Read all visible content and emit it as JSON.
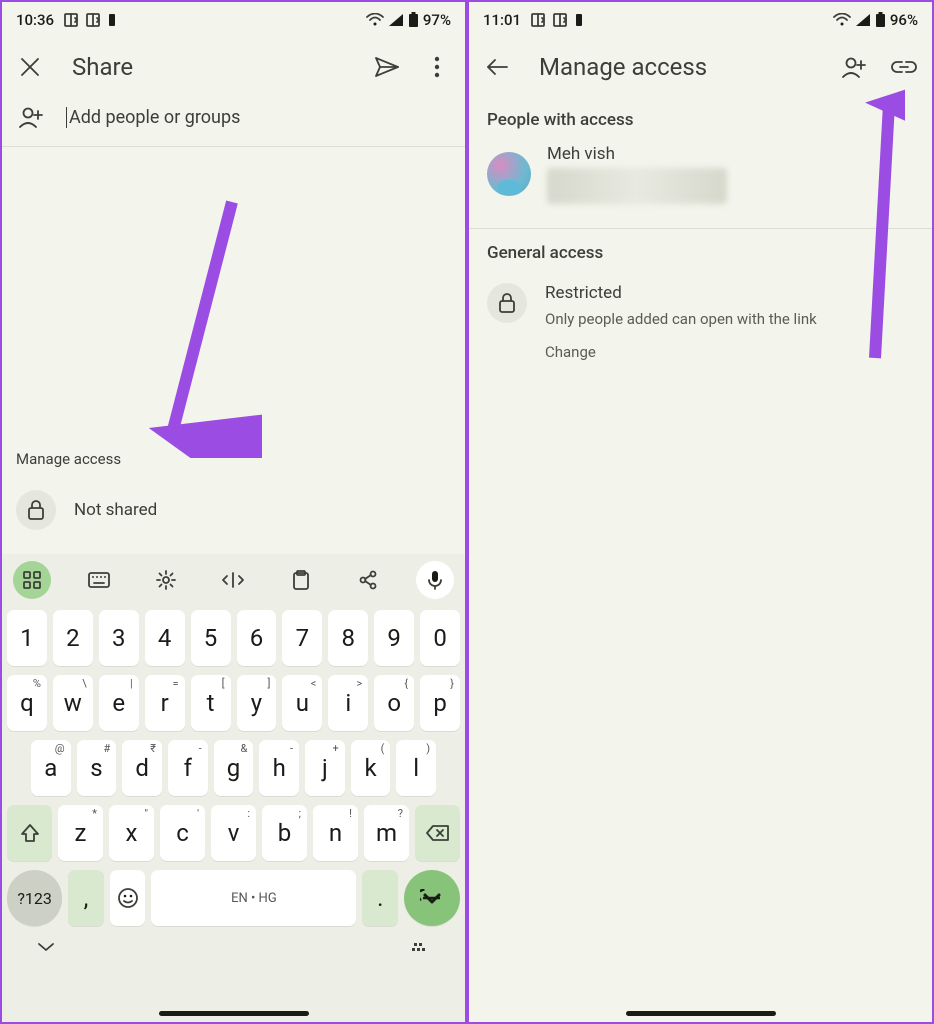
{
  "left": {
    "status": {
      "time": "10:36",
      "battery": "97%"
    },
    "header": {
      "title": "Share"
    },
    "input": {
      "placeholder": "Add people or groups"
    },
    "manage": {
      "label": "Manage access",
      "status": "Not shared"
    },
    "keyboard": {
      "row_nums": [
        "1",
        "2",
        "3",
        "4",
        "5",
        "6",
        "7",
        "8",
        "9",
        "0"
      ],
      "row_qwerty": [
        {
          "k": "q",
          "s": "%"
        },
        {
          "k": "w",
          "s": "\\"
        },
        {
          "k": "e",
          "s": "|"
        },
        {
          "k": "r",
          "s": "="
        },
        {
          "k": "t",
          "s": "["
        },
        {
          "k": "y",
          "s": "]"
        },
        {
          "k": "u",
          "s": "<"
        },
        {
          "k": "i",
          "s": ">"
        },
        {
          "k": "o",
          "s": "{"
        },
        {
          "k": "p",
          "s": "}"
        }
      ],
      "row_asdf": [
        {
          "k": "a",
          "s": "@"
        },
        {
          "k": "s",
          "s": "#"
        },
        {
          "k": "d",
          "s": "₹"
        },
        {
          "k": "f",
          "s": "-"
        },
        {
          "k": "g",
          "s": "&"
        },
        {
          "k": "h",
          "s": "-"
        },
        {
          "k": "j",
          "s": "+"
        },
        {
          "k": "k",
          "s": "("
        },
        {
          "k": "l",
          "s": ")"
        }
      ],
      "row_zxcv": [
        {
          "k": "z",
          "s": "*"
        },
        {
          "k": "x",
          "s": "\""
        },
        {
          "k": "c",
          "s": "'"
        },
        {
          "k": "v",
          "s": ":"
        },
        {
          "k": "b",
          "s": ";"
        },
        {
          "k": "n",
          "s": "!"
        },
        {
          "k": "m",
          "s": "?"
        }
      ],
      "sym": "?123",
      "space": "EN • HG"
    }
  },
  "right": {
    "status": {
      "time": "11:01",
      "battery": "96%"
    },
    "header": {
      "title": "Manage access"
    },
    "people": {
      "section": "People with access",
      "name": "Meh vish"
    },
    "general": {
      "section": "General access",
      "title": "Restricted",
      "sub": "Only people added can open with the link",
      "change": "Change"
    }
  }
}
